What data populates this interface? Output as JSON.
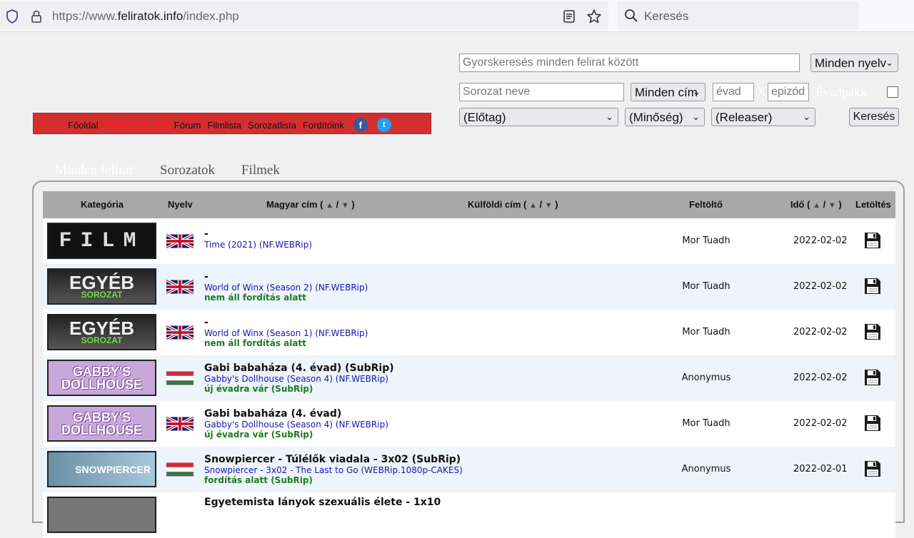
{
  "browser": {
    "url_prefix": "https://www.",
    "url_domain": "feliratok.info",
    "url_path": "/index.php",
    "search_placeholder": "Keresés"
  },
  "nav": {
    "items": [
      {
        "label": "Főoldal",
        "active": false
      },
      {
        "label": "Feliratbeküldés",
        "active": true
      },
      {
        "label": "Fórum",
        "active": false
      },
      {
        "label": "Filmlista",
        "active": false
      },
      {
        "label": "Sorozatlista",
        "active": false
      },
      {
        "label": "Fordítóink",
        "active": false
      }
    ],
    "facebook": "f",
    "twitter": "t"
  },
  "search": {
    "quick_placeholder": "Gyorskeresés minden felirat között",
    "language_select": "Minden nyelv",
    "series_placeholder": "Sorozat neve",
    "title_select": "Minden cím",
    "season_placeholder": "évad",
    "x_separator": "X",
    "episode_placeholder": "epizód",
    "season_pack_label": "Évadpakk",
    "prefix_select": "(Előtag)",
    "quality_select": "(Minőség)",
    "releaser_select": "(Releaser)",
    "search_button": "Keresés"
  },
  "tabs": [
    {
      "label": "Minden felirat",
      "active": true
    },
    {
      "label": "Sorozatok",
      "active": false
    },
    {
      "label": "Filmek",
      "active": false
    }
  ],
  "table": {
    "headers": {
      "category": "Kategória",
      "language": "Nyelv",
      "hungarian_title": "Magyar cím (",
      "foreign_title": "Külföldi cím (",
      "uploader": "Feltöltő",
      "time": "Idő (",
      "download": "Letöltés",
      "sort_sep": "/",
      "sort_close": ")"
    },
    "rows": [
      {
        "category": "FILM",
        "category_sub": "",
        "flag": "uk",
        "hu": "-",
        "en": "Time (2021) (NF.WEBRip)",
        "status": "",
        "uploader": "Mor Tuadh",
        "date": "2022-02-02"
      },
      {
        "category": "EGYÉB",
        "category_sub": "SOROZAT",
        "flag": "uk",
        "hu": "-",
        "en": "World of Winx (Season 2) (NF.WEBRip)",
        "status": "nem áll fordítás alatt",
        "uploader": "Mor Tuadh",
        "date": "2022-02-02"
      },
      {
        "category": "EGYÉB",
        "category_sub": "SOROZAT",
        "flag": "uk",
        "hu": "-",
        "en": "World of Winx (Season 1) (NF.WEBRip)",
        "status": "nem áll fordítás alatt",
        "uploader": "Mor Tuadh",
        "date": "2022-02-02"
      },
      {
        "category": "GABBY'S",
        "category_sub": "DOLLHOUSE",
        "flag": "hu",
        "hu": "Gabi babaháza (4. évad) (SubRip)",
        "en": "Gabby's Dollhouse (Season 4) (NF.WEBRip)",
        "status": "új évadra vár (SubRip)",
        "uploader": "Anonymus",
        "date": "2022-02-02"
      },
      {
        "category": "GABBY'S",
        "category_sub": "DOLLHOUSE",
        "flag": "uk",
        "hu": "Gabi babaháza (4. évad)",
        "en": "Gabby's Dollhouse (Season 4) (NF.WEBRip)",
        "status": "új évadra vár (SubRip)",
        "uploader": "Mor Tuadh",
        "date": "2022-02-02"
      },
      {
        "category": "SNOWPIERCER",
        "category_sub": "",
        "flag": "hu",
        "hu": "Snowpiercer - Túlélők viadala - 3x02 (SubRip)",
        "en": "Snowpiercer - 3x02 - The Last to Go (WEBRip.1080p-CAKES)",
        "status": "fordítás alatt (SubRip)",
        "uploader": "Anonymus",
        "date": "2022-02-01"
      },
      {
        "category": "",
        "category_sub": "",
        "flag": "",
        "hu": "Egyetemista lányok szexuális élete - 1x10",
        "en": "",
        "status": "",
        "uploader": "",
        "date": ""
      }
    ]
  }
}
